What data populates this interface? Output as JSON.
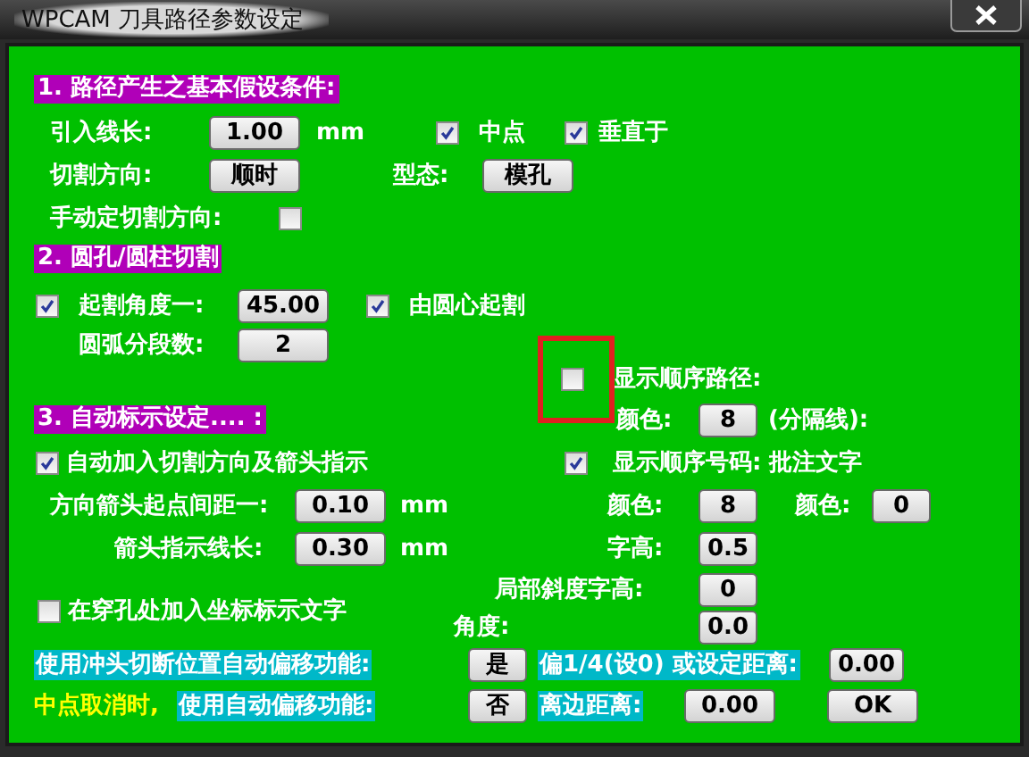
{
  "window": {
    "title": "WPCAM 刀具路径参数设定"
  },
  "section1": {
    "heading": "1. 路径产生之基本假设条件:",
    "lead_in_label": "引入线长:",
    "lead_in_value": "1.00",
    "lead_in_unit": "mm",
    "midpoint": {
      "label": "中点",
      "checked": true
    },
    "perpendicular": {
      "label": "垂直于",
      "checked": true
    },
    "direction_label": "切割方向:",
    "direction_value": "顺时",
    "type_label": "型态:",
    "type_value": "模孔",
    "manual_direction": {
      "label": "手动定切割方向:",
      "checked": false
    }
  },
  "section2": {
    "heading": "2. 圆孔/圆柱切割",
    "start_angle": {
      "label": "起割角度一:",
      "checked": true,
      "value": "45.00"
    },
    "from_center": {
      "label": "由圆心起割",
      "checked": true
    },
    "arc_segments_label": "圆弧分段数:",
    "arc_segments_value": "2"
  },
  "sequence_path": {
    "label": "显示顺序路径:",
    "checked": false,
    "highlighted": true,
    "color_label": "颜色:",
    "color_value": "8",
    "separator_label": "(分隔线):"
  },
  "section3": {
    "heading": "3. 自动标示设定.... :",
    "auto_arrow": {
      "label": "自动加入切割方向及箭头指示",
      "checked": true
    },
    "show_number": {
      "label": "显示顺序号码: 批注文字",
      "checked": true
    },
    "arrow_gap_label": "方向箭头起点间距一:",
    "arrow_gap_value": "0.10",
    "arrow_gap_unit": "mm",
    "arrow_length_label": "箭头指示线长:",
    "arrow_length_value": "0.30",
    "arrow_length_unit": "mm",
    "number_color_label": "颜色:",
    "number_color_value": "8",
    "note_color_label": "颜色:",
    "note_color_value": "0",
    "text_height_label": "字高:",
    "text_height_value": "0.5",
    "slope_text_height_label": "局部斜度字高:",
    "slope_text_height_value": "0",
    "angle_label": "角度:",
    "angle_value": "0.0",
    "coordinate_text": {
      "label": "在穿孔处加入坐标标示文字",
      "checked": false
    }
  },
  "offset": {
    "punch_label": "使用冲头切断位置自动偏移功能:",
    "punch_button": "是",
    "quarter_label": "偏1/4(设0) 或设定距离:",
    "quarter_value": "0.00",
    "midpoint_note": "中点取消时,",
    "auto_label": "使用自动偏移功能:",
    "auto_button": "否",
    "edge_label": "离边距离:",
    "edge_value": "0.00"
  },
  "buttons": [
    "OK"
  ]
}
